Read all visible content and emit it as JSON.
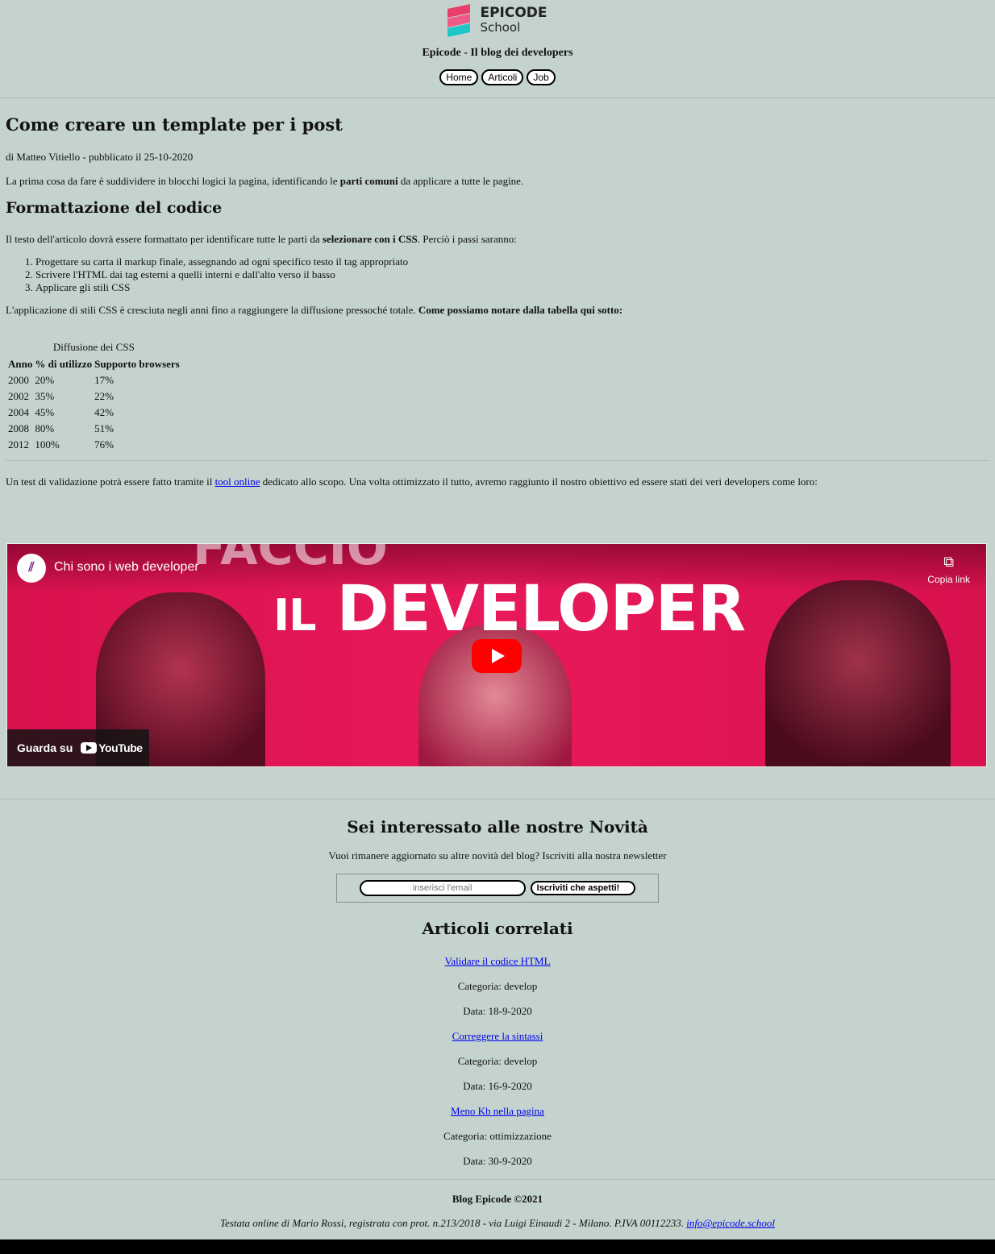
{
  "header": {
    "logo_line1": "EPICODE",
    "logo_line2": "School",
    "blog_title": "Epicode - Il blog dei developers",
    "nav": [
      {
        "label": "Home"
      },
      {
        "label": "Articoli"
      },
      {
        "label": "Job"
      }
    ]
  },
  "article": {
    "title": "Come creare un template per i post",
    "byline": "di Matteo Vitiello - pubblicato il 25-10-2020",
    "intro_before": "La prima cosa da fare è suddividere in blocchi logici la pagina, identificando le ",
    "intro_bold": "parti comuni",
    "intro_after": " da applicare a tutte le pagine.",
    "section_title": "Formattazione del codice",
    "section_before": "Il testo dell'articolo dovrà essere formattato per identificare tutte le parti da ",
    "section_bold": "selezionare con i CSS",
    "section_after": ". Perciò i passi saranno:",
    "steps": [
      "Progettare su carta il markup finale, assegnando ad ogni specifico testo il tag appropriato",
      "Scrivere l'HTML dai tag esterni a quelli interni e dall'alto verso il basso",
      "Applicare gli stili CSS"
    ],
    "css_before": "L'applicazione di stili CSS è cresciuta negli anni fino a raggiungere la diffusione pressoché totale. ",
    "css_bold": "Come possiamo notare dalla tabella qui sotto:",
    "table": {
      "caption": "Diffusione dei CSS",
      "headers": [
        "Anno",
        "% di utilizzo",
        "Supporto browsers"
      ],
      "rows": [
        [
          "2000",
          "20%",
          "17%"
        ],
        [
          "2002",
          "35%",
          "22%"
        ],
        [
          "2004",
          "45%",
          "42%"
        ],
        [
          "2008",
          "80%",
          "51%"
        ],
        [
          "2012",
          "100%",
          "76%"
        ]
      ]
    },
    "validation_before": "Un test di validazione potrà essere fatto tramite il ",
    "validation_link": "tool online",
    "validation_after": " dedicato allo scopo. Una volta ottimizzato il tutto, avremo raggiunto il nostro obiettivo ed essere stati dei veri developers come loro:"
  },
  "video": {
    "title": "Chi sono i web developer",
    "copy_label": "Copia link",
    "watch_label": "Guarda su",
    "youtube_label": "YouTube",
    "overlay_top": "FACCIO",
    "overlay_small": "IL",
    "overlay_big": "DEVELOPER"
  },
  "newsletter": {
    "title": "Sei interessato alle nostre Novità",
    "text": "Vuoi rimanere aggiornato su altre novità del blog? Iscriviti alla nostra newsletter",
    "email_placeholder": "inserisci l'email",
    "subscribe_label": "Iscriviti che aspetti!"
  },
  "related": {
    "title": "Articoli correlati",
    "items": [
      {
        "title": "Validare il codice HTML",
        "category": "Categoria: develop",
        "date": "Data: 18-9-2020"
      },
      {
        "title": "Correggere la sintassi",
        "category": "Categoria: develop",
        "date": "Data: 16-9-2020"
      },
      {
        "title": "Meno Kb nella pagina",
        "category": "Categoria: ottimizzazione",
        "date": "Data: 30-9-2020"
      }
    ]
  },
  "footer": {
    "copyright": "Blog Epicode ©2021",
    "testata": "Testata online di Mario Rossi, registrata con prot. n.213/2018 - via Luigi Einaudi 2 - Milano. P.IVA 00112233. ",
    "email": "info@epicode.school"
  }
}
